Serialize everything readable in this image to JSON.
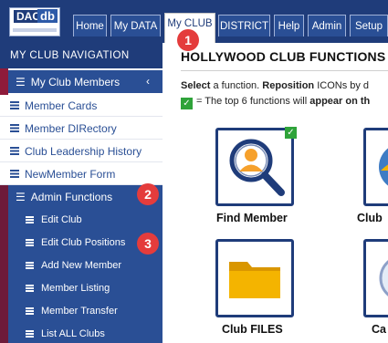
{
  "header": {
    "logo_text_1": "DAC",
    "logo_text_2": "db",
    "tabs": [
      {
        "label": "Home",
        "active": false
      },
      {
        "label": "My DATA",
        "active": false
      },
      {
        "label": "My CLUB",
        "active": true
      },
      {
        "label": "DISTRICT",
        "active": false
      },
      {
        "label": "Help",
        "active": false
      },
      {
        "label": "Admin",
        "active": false
      },
      {
        "label": "Setup",
        "active": false
      }
    ]
  },
  "callouts": [
    "1",
    "2",
    "3"
  ],
  "sidebar": {
    "heading": "MY CLUB NAVIGATION",
    "members_section": "My Club Members",
    "members_links": [
      "Member Cards",
      "Member DIRectory",
      "Club Leadership History",
      "NewMember Form"
    ],
    "admin_section": "Admin Functions",
    "admin_links": [
      "Edit Club",
      "Edit Club Positions",
      "Add New Member",
      "Member Listing",
      "Member Transfer",
      "List ALL Clubs"
    ]
  },
  "main": {
    "title": "HOLLYWOOD CLUB FUNCTIONS",
    "instruction_bold_1": "Select",
    "instruction_text_1": " a function. ",
    "instruction_bold_2": "Reposition",
    "instruction_text_2": " ICONs by d",
    "note_text": "= The top 6 functions will ",
    "note_bold": "appear on th",
    "cards": [
      {
        "label": "Find Member",
        "icon": "find-member-icon",
        "checked": true
      },
      {
        "label": "Club",
        "icon": "club-icon",
        "checked": false
      },
      {
        "label": "Club FILES",
        "icon": "folder-icon",
        "checked": false
      },
      {
        "label": "Ca",
        "icon": "calendar-icon",
        "checked": false
      }
    ]
  },
  "colors": {
    "navy": "#1f3c7a",
    "blue": "#2a4f95",
    "maroon": "#8e1b3a",
    "badge_red": "#e43c3c",
    "check_green": "#2fa33a",
    "folder_yellow": "#f4b400"
  }
}
